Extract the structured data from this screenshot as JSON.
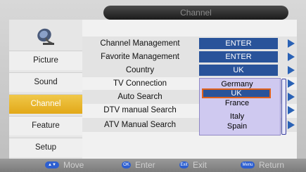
{
  "header": {
    "title": "Channel"
  },
  "sidebar": {
    "items": [
      {
        "label": "Picture"
      },
      {
        "label": "Sound"
      },
      {
        "label": "Channel"
      },
      {
        "label": "Feature"
      },
      {
        "label": "Setup"
      }
    ]
  },
  "menu": {
    "rows": [
      {
        "label": "Channel Management",
        "value": "ENTER"
      },
      {
        "label": "Favorite Management",
        "value": "ENTER"
      },
      {
        "label": "Country",
        "value": "UK"
      },
      {
        "label": "TV Connection",
        "value": ""
      },
      {
        "label": "Auto Search",
        "value": ""
      },
      {
        "label": "DTV manual Search",
        "value": ""
      },
      {
        "label": "ATV Manual Search",
        "value": ""
      }
    ]
  },
  "country_dropdown": {
    "options": [
      "Germany",
      "UK",
      "France",
      "Italy",
      "Spain"
    ],
    "selected": "UK"
  },
  "footer": {
    "move": "Move",
    "enter": "Enter",
    "exit": "Exit",
    "return": "Return",
    "move_key": "▲▼",
    "enter_key": "OK",
    "exit_key": "Exit",
    "return_key": "Menu"
  },
  "colors": {
    "accent": "#29539a",
    "selected_tab": "#e8b22a",
    "highlight_border": "#e0601a"
  }
}
